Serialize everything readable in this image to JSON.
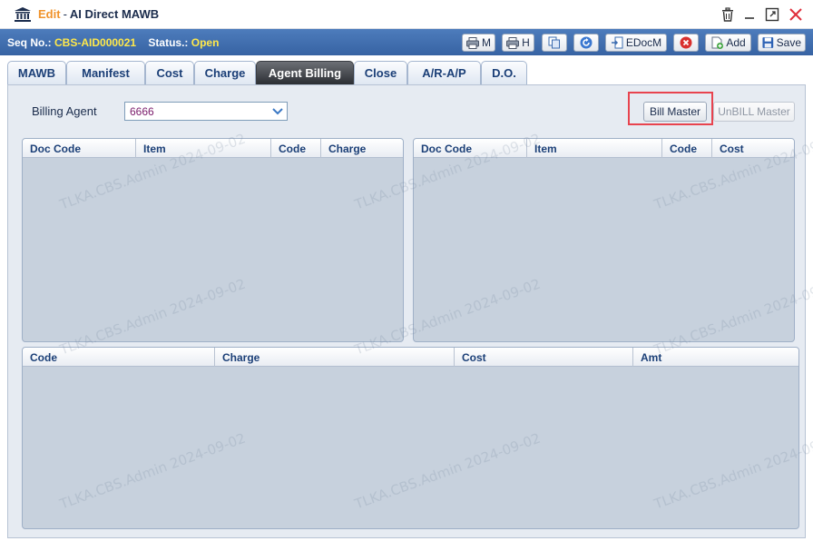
{
  "window": {
    "mode": "Edit",
    "separator": "-",
    "title": "AI Direct MAWB"
  },
  "header": {
    "seq_label": "Seq No.:",
    "seq_value": "CBS-AID000021",
    "status_label": "Status.:",
    "status_value": "Open"
  },
  "toolbar": {
    "print_m": "M",
    "print_h": "H",
    "edocm": "EDocM",
    "add": "Add",
    "save": "Save"
  },
  "tabs": [
    "MAWB",
    "Manifest",
    "Cost",
    "Charge",
    "Agent Billing",
    "Close",
    "A/R-A/P",
    "D.O."
  ],
  "active_tab": "Agent Billing",
  "billing": {
    "agent_label": "Billing Agent",
    "agent_value": "6666",
    "bill_master": "Bill Master",
    "unbill_master": "UnBILL Master"
  },
  "grid_left": {
    "columns": [
      "Doc Code",
      "Item",
      "Code",
      "Charge"
    ]
  },
  "grid_right": {
    "columns": [
      "Doc Code",
      "Item",
      "Code",
      "Cost"
    ]
  },
  "grid_bottom": {
    "columns": [
      "Code",
      "Charge",
      "Cost",
      "Amt"
    ]
  },
  "watermark": "TLKA.CBS.Admin 2024-09-02",
  "colors": {
    "header_bar": "#4679bb",
    "accent_yellow": "#ffe84a",
    "mode_orange": "#f0932b",
    "active_tab": "#2f3237",
    "highlight": "#e8434e",
    "grid_body": "#c7d1dd"
  }
}
